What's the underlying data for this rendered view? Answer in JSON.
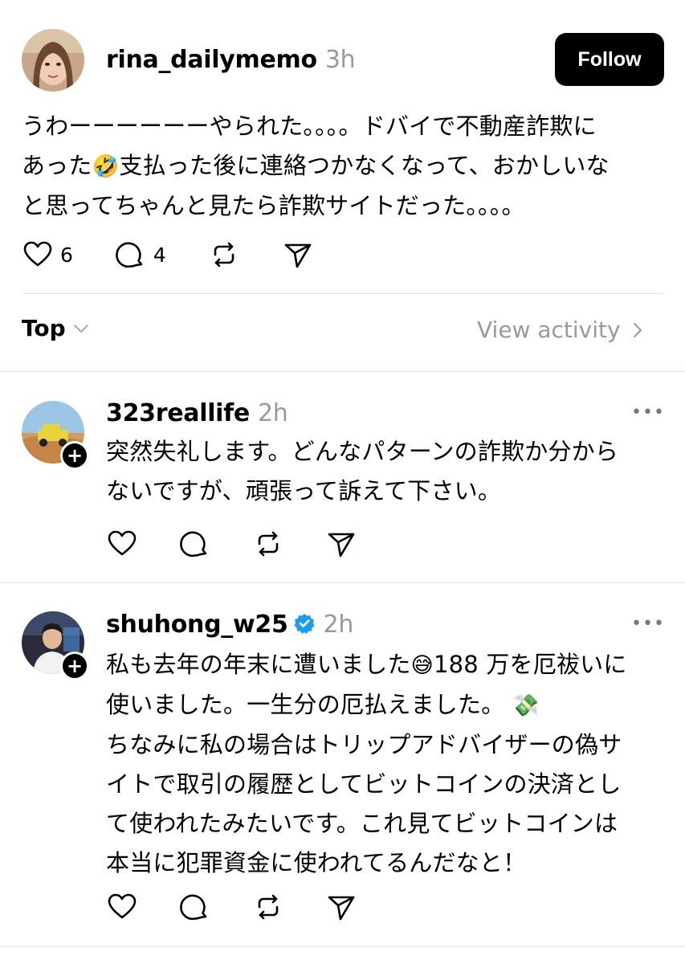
{
  "post": {
    "username": "rina_dailymemo",
    "time": "3h",
    "follow_label": "Follow",
    "text_line1": "うわーーーーーーやられた。。。。ドバイで不動産詐欺に",
    "text_line2a": "あった",
    "text_line2_emoji": "🤣",
    "text_line2b": "支払った後に連絡つかなくなって、おかしいな",
    "text_line3": "と思ってちゃんと見たら詐欺サイトだった。。。。",
    "likes": "6",
    "comments": "4"
  },
  "sort": {
    "label": "Top",
    "view_activity": "View activity"
  },
  "replies": [
    {
      "username": "323reallife",
      "time": "2h",
      "more": "•••",
      "line1": "突然失礼します。どんなパターンの詐欺か分から",
      "line2": "ないですが、頑張って訴えて下さい。"
    },
    {
      "username": "shuhong_w25",
      "time": "2h",
      "more": "•••",
      "line1a": "私も去年の年末に遭いました",
      "line1_emoji": "😅",
      "line1b": "188 万を厄祓いに",
      "line2a": "使いました。一生分の厄払えました。",
      "line2_emoji": "💸",
      "line3": "ちなみに私の場合はトリップアドバイザーの偽サ",
      "line4": "イトで取引の履歴としてビットコインの決済とし",
      "line5": "て使われたみたいです。これ見てビットコインは",
      "line6": "本当に犯罪資金に使われてるんだなと！"
    }
  ],
  "icons": [
    "heart-icon",
    "comment-icon",
    "repost-icon",
    "share-icon",
    "chevron-down-icon",
    "chevron-right-icon",
    "plus-icon",
    "verified-icon"
  ],
  "colors": {
    "verified": "#1d9bf0",
    "muted": "#999999",
    "follow_bg": "#000000"
  }
}
